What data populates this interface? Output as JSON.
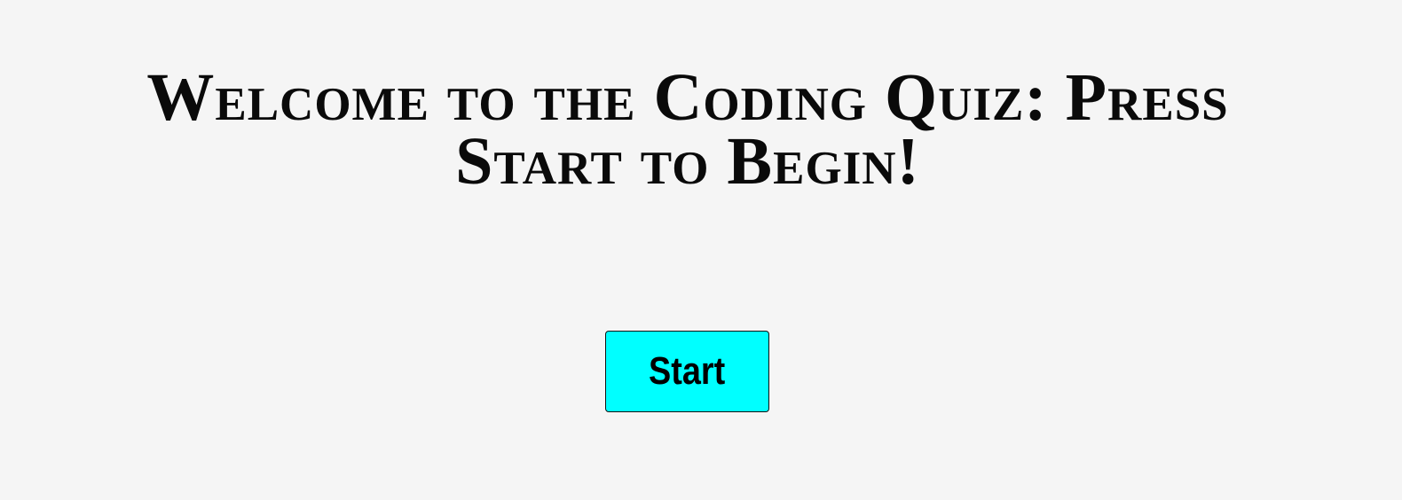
{
  "header": {
    "title": "Welcome to the Coding Quiz: Press Start to Begin!"
  },
  "actions": {
    "start_label": "Start"
  },
  "colors": {
    "background": "#f5f5f5",
    "button_background": "#00ffff",
    "text": "#0a0a0a"
  }
}
